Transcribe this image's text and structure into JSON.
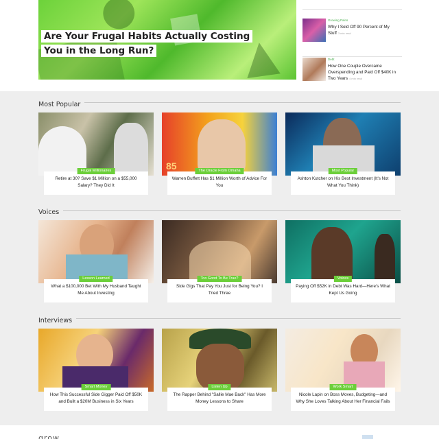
{
  "hero": {
    "title": "Are Your Frugal Habits Actually Costing You in the Long Run?"
  },
  "sidebar": {
    "items": [
      {
        "category": "Growing Pains",
        "title": "Why I Sold Off 90 Percent of My Stuff",
        "read_time": "3 min read"
      },
      {
        "category": "Debt",
        "title": "How One Couple Overcame Overspending and Paid Off $40K in Two Years",
        "read_time": "4 min read"
      }
    ]
  },
  "sections": [
    {
      "heading": "Most Popular",
      "cards": [
        {
          "tag": "Frugal Millionaires",
          "title": "Retire at 30? Save $1 Million on a $55,000 Salary? They Did It"
        },
        {
          "tag": "The Oracle From Omaha",
          "title": "Warren Buffett Has $1 Million Worth of Advice For You"
        },
        {
          "tag": "Most Popular",
          "title": "Ashton Kutcher on His Best Investment (It's Not What You Think)"
        }
      ]
    },
    {
      "heading": "Voices",
      "cards": [
        {
          "tag": "Lesson Learned",
          "title": "What a $100,000 Bet With My Husband Taught Me About Investing"
        },
        {
          "tag": "Too Good To Be True?",
          "title": "Side Gigs That Pay You Just for Being You? I Tried Three"
        },
        {
          "tag": "Voices",
          "title": "Paying Off $52K in Debt Was Hard—Here's What Kept Us Going"
        }
      ]
    },
    {
      "heading": "Interviews",
      "cards": [
        {
          "tag": "Smart Money",
          "title": "How This Successful Side Gigger Paid Off $50K and Built a $20M Business in Six Years"
        },
        {
          "tag": "Listen Up",
          "title": "The Rapper Behind \"Sallie Mae Back\" Has More Money Lessons to Share"
        },
        {
          "tag": "Work Smart",
          "title": "Nicole Lapin on Boss Moves, Budgeting—and Why She Loves Talking About Her Financial Fails"
        }
      ]
    }
  ],
  "footer": {
    "logo": "grow"
  },
  "colors": {
    "accent_green": "#6ccf3a",
    "background": "#eeeeee"
  }
}
